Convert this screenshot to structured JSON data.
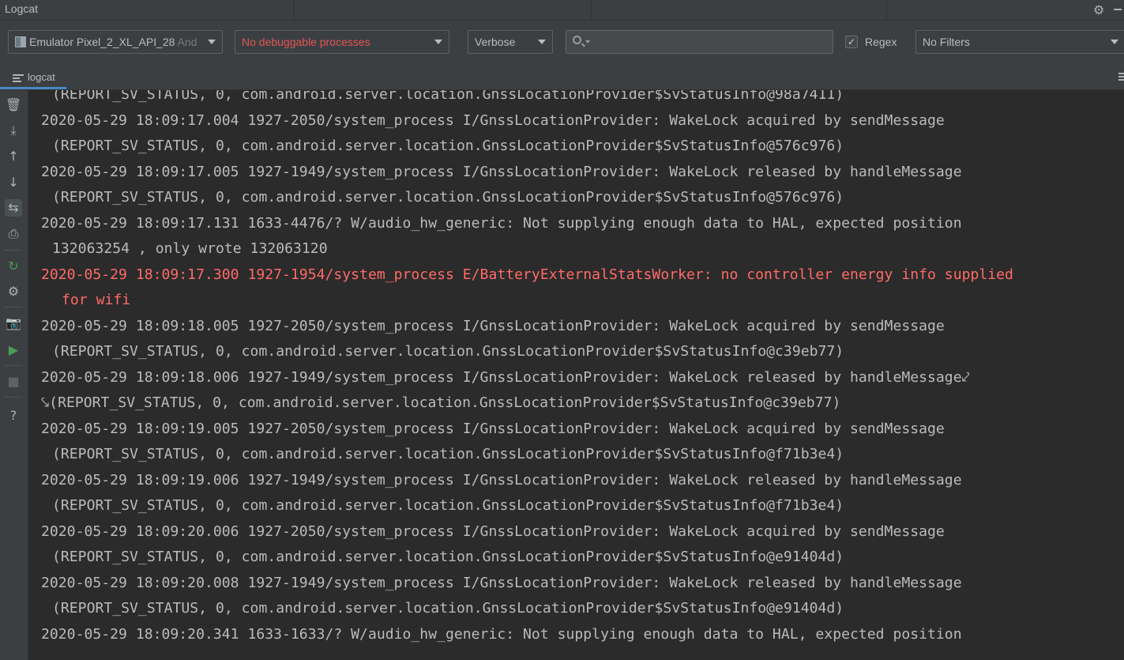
{
  "window": {
    "title": "Logcat"
  },
  "toolbar": {
    "device": {
      "name": "Emulator Pixel_2_XL_API_28",
      "suffix": " And"
    },
    "process": "No debuggable processes",
    "level": "Verbose",
    "search": {
      "value": "",
      "placeholder": ""
    },
    "regex": {
      "checked": true,
      "label": "Regex"
    },
    "filter": "No Filters"
  },
  "tab": {
    "label": "logcat"
  },
  "icons": {
    "settings": "gear-icon",
    "minimize": "minimize-icon",
    "sidebar": [
      "trash-icon",
      "scroll-to-end-icon",
      "up-arrow-icon",
      "down-arrow-icon",
      "soft-wrap-icon",
      "print-icon",
      "restart-icon",
      "settings-icon",
      "screenshot-icon",
      "screen-record-icon",
      "stop-icon",
      "help-icon"
    ]
  },
  "colors": {
    "error": "#ff6b68",
    "text": "#bbbbbb",
    "process_error": "#e05555",
    "tab_underline": "#4a88c7"
  },
  "log": {
    "lines": [
      {
        "text": "(REPORT_SV_STATUS, 0, com.android.server.location.GnssLocationProvider$SvStatusInfo@98a7411)",
        "cont": true,
        "level": "I"
      },
      {
        "text": "2020-05-29 18:09:17.004 1927-2050/system_process I/GnssLocationProvider: WakeLock acquired by sendMessage",
        "cont": false,
        "level": "I"
      },
      {
        "text": "(REPORT_SV_STATUS, 0, com.android.server.location.GnssLocationProvider$SvStatusInfo@576c976)",
        "cont": true,
        "level": "I"
      },
      {
        "text": "2020-05-29 18:09:17.005 1927-1949/system_process I/GnssLocationProvider: WakeLock released by handleMessage",
        "cont": false,
        "level": "I"
      },
      {
        "text": "(REPORT_SV_STATUS, 0, com.android.server.location.GnssLocationProvider$SvStatusInfo@576c976)",
        "cont": true,
        "level": "I"
      },
      {
        "text": "2020-05-29 18:09:17.131 1633-4476/? W/audio_hw_generic: Not supplying enough data to HAL, expected position",
        "cont": false,
        "level": "W"
      },
      {
        "text": "132063254 , only wrote 132063120",
        "cont": true,
        "level": "W"
      },
      {
        "text": "2020-05-29 18:09:17.300 1927-1954/system_process E/BatteryExternalStatsWorker: no controller energy info supplied",
        "cont": false,
        "level": "E"
      },
      {
        "text": "for wifi",
        "cont": true,
        "level": "E"
      },
      {
        "text": "2020-05-29 18:09:18.005 1927-2050/system_process I/GnssLocationProvider: WakeLock acquired by sendMessage",
        "cont": false,
        "level": "I"
      },
      {
        "text": "(REPORT_SV_STATUS, 0, com.android.server.location.GnssLocationProvider$SvStatusInfo@c39eb77)",
        "cont": true,
        "level": "I"
      },
      {
        "text": "2020-05-29 18:09:18.006 1927-1949/system_process I/GnssLocationProvider: WakeLock released by handleMessage⤦",
        "cont": false,
        "level": "I"
      },
      {
        "text": "⤥(REPORT_SV_STATUS, 0, com.android.server.location.GnssLocationProvider$SvStatusInfo@c39eb77)",
        "cont": false,
        "level": "I"
      },
      {
        "text": "2020-05-29 18:09:19.005 1927-2050/system_process I/GnssLocationProvider: WakeLock acquired by sendMessage",
        "cont": false,
        "level": "I"
      },
      {
        "text": "(REPORT_SV_STATUS, 0, com.android.server.location.GnssLocationProvider$SvStatusInfo@f71b3e4)",
        "cont": true,
        "level": "I"
      },
      {
        "text": "2020-05-29 18:09:19.006 1927-1949/system_process I/GnssLocationProvider: WakeLock released by handleMessage",
        "cont": false,
        "level": "I"
      },
      {
        "text": "(REPORT_SV_STATUS, 0, com.android.server.location.GnssLocationProvider$SvStatusInfo@f71b3e4)",
        "cont": true,
        "level": "I"
      },
      {
        "text": "2020-05-29 18:09:20.006 1927-2050/system_process I/GnssLocationProvider: WakeLock acquired by sendMessage",
        "cont": false,
        "level": "I"
      },
      {
        "text": "(REPORT_SV_STATUS, 0, com.android.server.location.GnssLocationProvider$SvStatusInfo@e91404d)",
        "cont": true,
        "level": "I"
      },
      {
        "text": "2020-05-29 18:09:20.008 1927-1949/system_process I/GnssLocationProvider: WakeLock released by handleMessage",
        "cont": false,
        "level": "I"
      },
      {
        "text": "(REPORT_SV_STATUS, 0, com.android.server.location.GnssLocationProvider$SvStatusInfo@e91404d)",
        "cont": true,
        "level": "I"
      },
      {
        "text": "2020-05-29 18:09:20.341 1633-1633/? W/audio_hw_generic: Not supplying enough data to HAL, expected position",
        "cont": false,
        "level": "W"
      }
    ]
  }
}
